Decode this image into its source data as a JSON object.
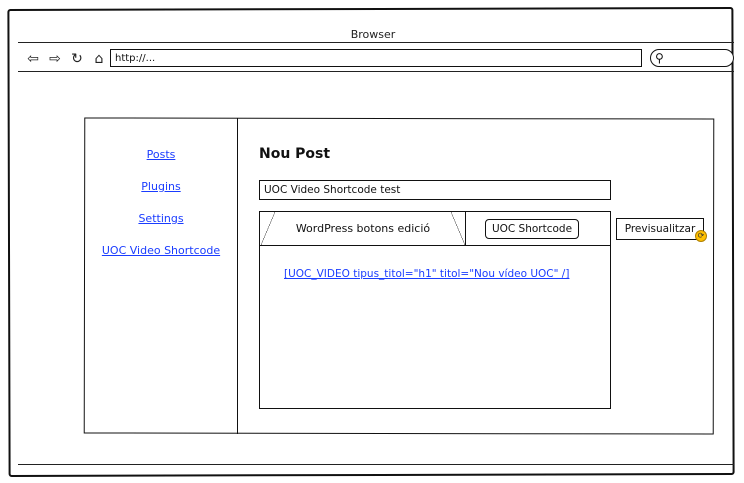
{
  "browser": {
    "title": "Browser",
    "address": "http://...",
    "icons": {
      "back": "back-arrow-icon",
      "forward": "forward-arrow-icon",
      "reload": "reload-icon",
      "home": "home-icon",
      "search": "search-icon"
    }
  },
  "sidebar": {
    "items": [
      {
        "label": "Posts"
      },
      {
        "label": "Plugins"
      },
      {
        "label": "Settings"
      },
      {
        "label": "UOC Video Shortcode"
      }
    ]
  },
  "main": {
    "heading": "Nou Post",
    "title_value": "UOC Video Shortcode test",
    "tabs": {
      "wordpress": "WordPress botons edició",
      "uoc_shortcode": "UOC Shortcode"
    },
    "editor_content": "[UOC_VIDEO tipus_titol=\"h1\" titol=\"Nou vídeo UOC\" /]",
    "preview_button": "Previsualitzar"
  },
  "colors": {
    "link": "#1a3cff",
    "badge": "#ffc000"
  }
}
